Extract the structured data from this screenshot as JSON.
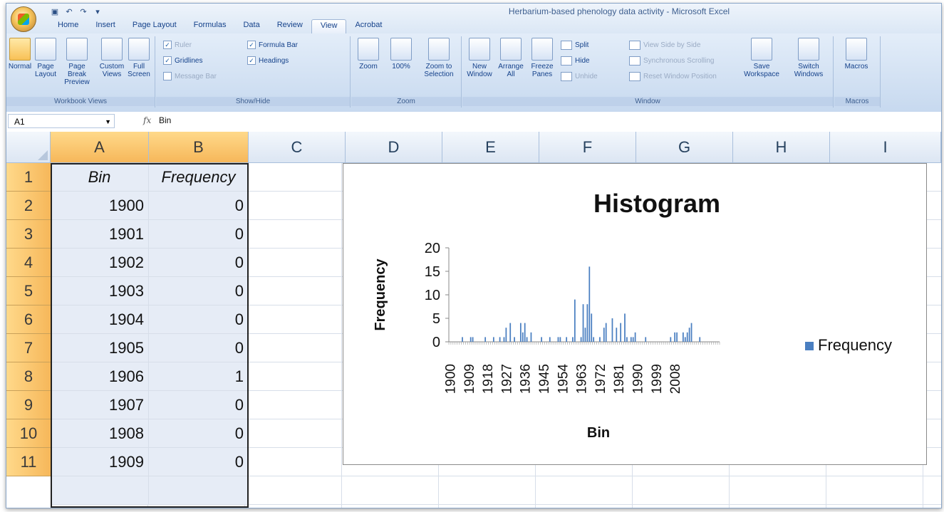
{
  "window": {
    "title": "Herbarium-based phenology data activity - Microsoft Excel"
  },
  "ribbon_tabs": [
    "Home",
    "Insert",
    "Page Layout",
    "Formulas",
    "Data",
    "Review",
    "View",
    "Acrobat"
  ],
  "active_tab": "View",
  "ribbon": {
    "workbook_views": {
      "label": "Workbook Views",
      "normal": "Normal",
      "page_layout": "Page Layout",
      "page_break_preview": "Page Break Preview",
      "custom_views": "Custom Views",
      "full_screen": "Full Screen"
    },
    "show_hide": {
      "label": "Show/Hide",
      "ruler": "Ruler",
      "gridlines": "Gridlines",
      "message_bar": "Message Bar",
      "formula_bar": "Formula Bar",
      "headings": "Headings"
    },
    "zoom": {
      "label": "Zoom",
      "zoom": "Zoom",
      "hundred": "100%",
      "zoom_to_selection": "Zoom to Selection"
    },
    "window": {
      "label": "Window",
      "new_window": "New Window",
      "arrange_all": "Arrange All",
      "freeze_panes": "Freeze Panes",
      "split": "Split",
      "hide": "Hide",
      "unhide": "Unhide",
      "view_side_by_side": "View Side by Side",
      "synchronous_scrolling": "Synchronous Scrolling",
      "reset_window_position": "Reset Window Position",
      "save_workspace": "Save Workspace",
      "switch_windows": "Switch Windows"
    },
    "macros": {
      "label": "Macros",
      "macros": "Macros"
    }
  },
  "formula_bar": {
    "name_box": "A1",
    "fx": "fx",
    "value": "Bin"
  },
  "columns": [
    "A",
    "B",
    "C",
    "D",
    "E",
    "F",
    "G",
    "H",
    "I"
  ],
  "rows": [
    "1",
    "2",
    "3",
    "4",
    "5",
    "6",
    "7",
    "8",
    "9",
    "10",
    "11"
  ],
  "table": {
    "headers": [
      "Bin",
      "Frequency"
    ],
    "data": [
      [
        "1900",
        "0"
      ],
      [
        "1901",
        "0"
      ],
      [
        "1902",
        "0"
      ],
      [
        "1903",
        "0"
      ],
      [
        "1904",
        "0"
      ],
      [
        "1905",
        "0"
      ],
      [
        "1906",
        "1"
      ],
      [
        "1907",
        "0"
      ],
      [
        "1908",
        "0"
      ],
      [
        "1909",
        "0"
      ]
    ]
  },
  "chart_data": {
    "type": "bar",
    "title": "Histogram",
    "xlabel": "Bin",
    "ylabel": "Frequency",
    "ylim": [
      0,
      20
    ],
    "yticks": [
      0,
      5,
      10,
      15,
      20
    ],
    "xtick_labels": [
      "1900",
      "1909",
      "1918",
      "1927",
      "1936",
      "1945",
      "1954",
      "1963",
      "1972",
      "1981",
      "1990",
      "1999",
      "2008"
    ],
    "legend": "right",
    "series": [
      {
        "name": "Frequency",
        "color": "#4a7fc1",
        "x_start": 1900,
        "values": [
          0,
          0,
          0,
          0,
          0,
          0,
          1,
          0,
          0,
          0,
          1,
          1,
          0,
          0,
          0,
          0,
          0,
          1,
          0,
          0,
          0,
          1,
          0,
          0,
          1,
          0,
          1,
          3,
          0,
          4,
          0,
          1,
          0,
          0,
          4,
          2,
          4,
          1,
          0,
          2,
          0,
          0,
          0,
          0,
          1,
          0,
          0,
          0,
          1,
          0,
          0,
          0,
          1,
          1,
          0,
          0,
          1,
          0,
          0,
          1,
          9,
          0,
          0,
          1,
          8,
          3,
          8,
          16,
          6,
          1,
          0,
          0,
          1,
          0,
          3,
          4,
          0,
          0,
          5,
          0,
          3,
          0,
          4,
          0,
          6,
          1,
          0,
          1,
          1,
          2,
          0,
          0,
          0,
          0,
          1,
          0,
          0,
          0,
          0,
          0,
          0,
          0,
          0,
          0,
          0,
          0,
          1,
          0,
          2,
          2,
          0,
          0,
          2,
          1,
          2,
          3,
          4,
          0,
          0,
          0,
          1,
          0,
          0,
          0,
          0,
          0,
          0,
          0,
          0,
          0
        ]
      }
    ]
  }
}
